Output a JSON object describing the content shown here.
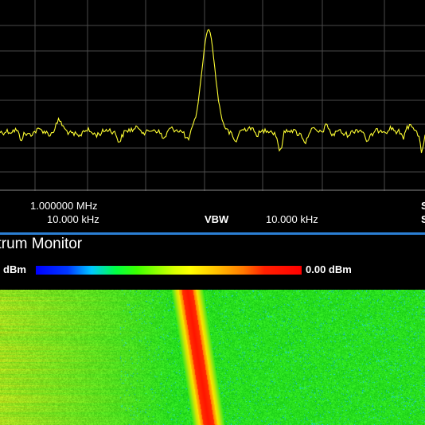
{
  "app": {
    "title": "ctrum Monitor"
  },
  "info_panel": {
    "span_value": "1.000000 MHz",
    "rbw_value": "10.000 kHz",
    "vbw_label": "VBW",
    "vbw_value": "10.000 kHz",
    "right_edge_top": "S",
    "right_edge_bottom": "S"
  },
  "waterfall_scale": {
    "min_label": "dBm",
    "max_label": "0.00 dBm",
    "gradient": [
      "#0000ff",
      "#00c8ff",
      "#00ff44",
      "#d6ff00",
      "#ffff00",
      "#ff7a00",
      "#ff0000"
    ]
  },
  "colors": {
    "trace": "#ffff33",
    "grid": "#4a4a4a",
    "separator": "#2b7fd4",
    "waterfall_background": "#33dd22",
    "signal_core": "#ff1a00"
  },
  "chart_data": {
    "type": "line",
    "title": "",
    "xlabel": "",
    "ylabel": "",
    "grid": true,
    "peak": {
      "position": "center",
      "relative_level": "high"
    }
  }
}
